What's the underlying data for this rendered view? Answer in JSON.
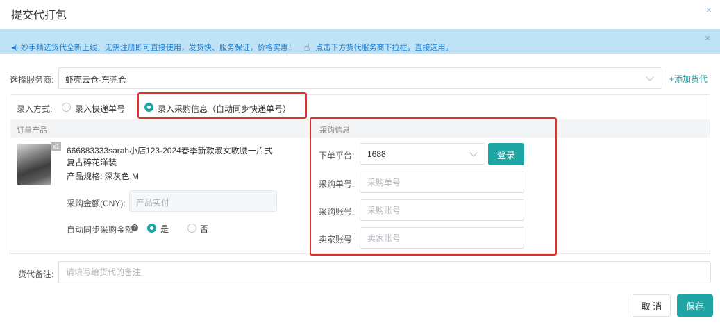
{
  "dialog": {
    "title": "提交代打包",
    "close_icon": "×"
  },
  "notice": {
    "speaker_icon": "◀)",
    "text": "妙手精选货代全新上线，无需注册即可直接使用，发货快、服务保证，价格实惠！",
    "hand_icon": "☝",
    "cta": "点击下方货代服务商下拉框，直接选用。",
    "close_icon": "×",
    "bg_color": "#bfe2f6",
    "text_color": "#1f7fd0"
  },
  "provider": {
    "label": "选择服务商:",
    "value": "虾壳云仓-东莞仓",
    "add_label": "+添加货代"
  },
  "entry_mode": {
    "label": "录入方式:",
    "options": [
      "录入快递单号",
      "录入采购信息（自动同步快递单号）"
    ],
    "selected": "录入采购信息（自动同步快递单号）"
  },
  "order": {
    "heading": "订单产品",
    "badge": "x1",
    "title": "666883333sarah小店123-2024春季新款淑女收腰一片式复古碎花洋装",
    "spec": "产品规格:  深灰色,M",
    "amount_label": "采购金额(CNY):",
    "amount_placeholder": "产品实付",
    "sync_label": "自动同步采购金额",
    "help_icon": "?",
    "sync_yes": "是",
    "sync_no": "否",
    "sync_selected": "是"
  },
  "purchase": {
    "heading": "采购信息",
    "platform_label": "下单平台:",
    "platform_value": "1688",
    "login_label": "登录",
    "order_no_label": "采购单号:",
    "order_no_placeholder": "采购单号",
    "account_label": "采购账号:",
    "account_placeholder": "采购账号",
    "seller_label": "卖家账号:",
    "seller_placeholder": "卖家账号"
  },
  "remarks": {
    "label": "货代备注:",
    "placeholder": "请填写给货代的备注"
  },
  "footer": {
    "cancel": "取 消",
    "save": "保存"
  },
  "colors": {
    "accent": "#1fa6a4",
    "highlight_border": "#e0302a"
  }
}
